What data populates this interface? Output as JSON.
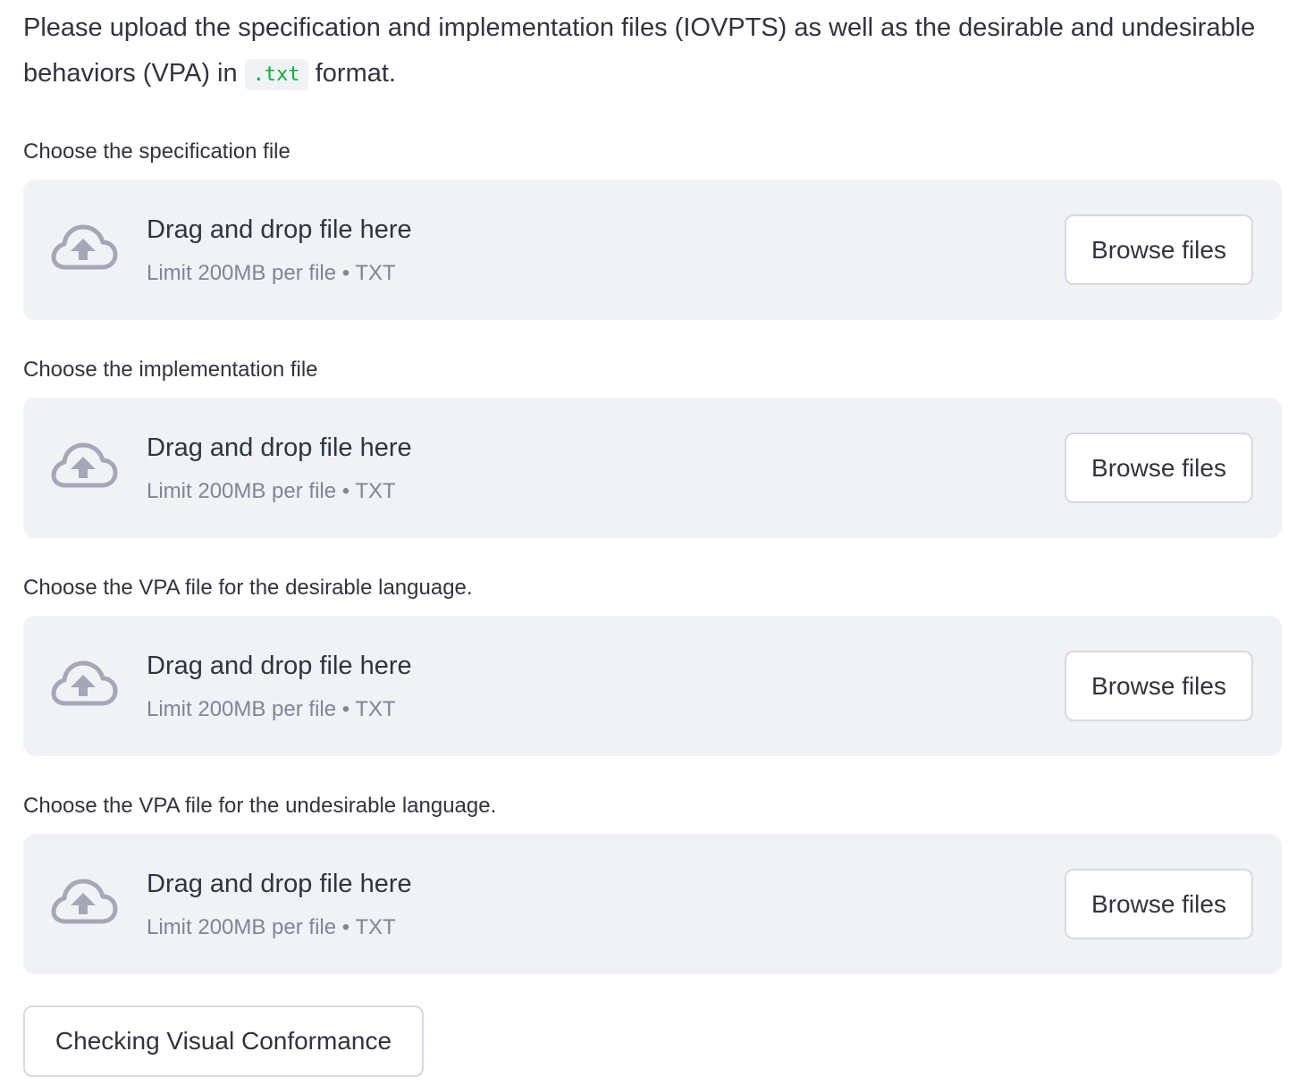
{
  "intro": {
    "text_before": "Please upload the specification and implementation files (IOVPTS) as well as the desirable and undesirable behaviors (VPA) in ",
    "code": ".txt",
    "text_after": " format."
  },
  "uploaders": [
    {
      "label": "Choose the specification file",
      "dropzone_title": "Drag and drop file here",
      "limit_text": "Limit 200MB per file • TXT",
      "button_label": "Browse files",
      "icon": "cloud-upload-icon"
    },
    {
      "label": "Choose the implementation file",
      "dropzone_title": "Drag and drop file here",
      "limit_text": "Limit 200MB per file • TXT",
      "button_label": "Browse files",
      "icon": "cloud-upload-icon"
    },
    {
      "label": "Choose the VPA file for the desirable language.",
      "dropzone_title": "Drag and drop file here",
      "limit_text": "Limit 200MB per file • TXT",
      "button_label": "Browse files",
      "icon": "cloud-upload-icon"
    },
    {
      "label": "Choose the VPA file for the undesirable language.",
      "dropzone_title": "Drag and drop file here",
      "limit_text": "Limit 200MB per file • TXT",
      "button_label": "Browse files",
      "icon": "cloud-upload-icon"
    }
  ],
  "actions": {
    "check_label": "Checking Visual Conformance"
  },
  "colors": {
    "text": "#31333f",
    "muted_text": "#808495",
    "dropzone_bg": "#f0f2f6",
    "code_text": "#09ab3b",
    "button_border": "#d7d9e0",
    "icon": "#a3a8b8"
  }
}
